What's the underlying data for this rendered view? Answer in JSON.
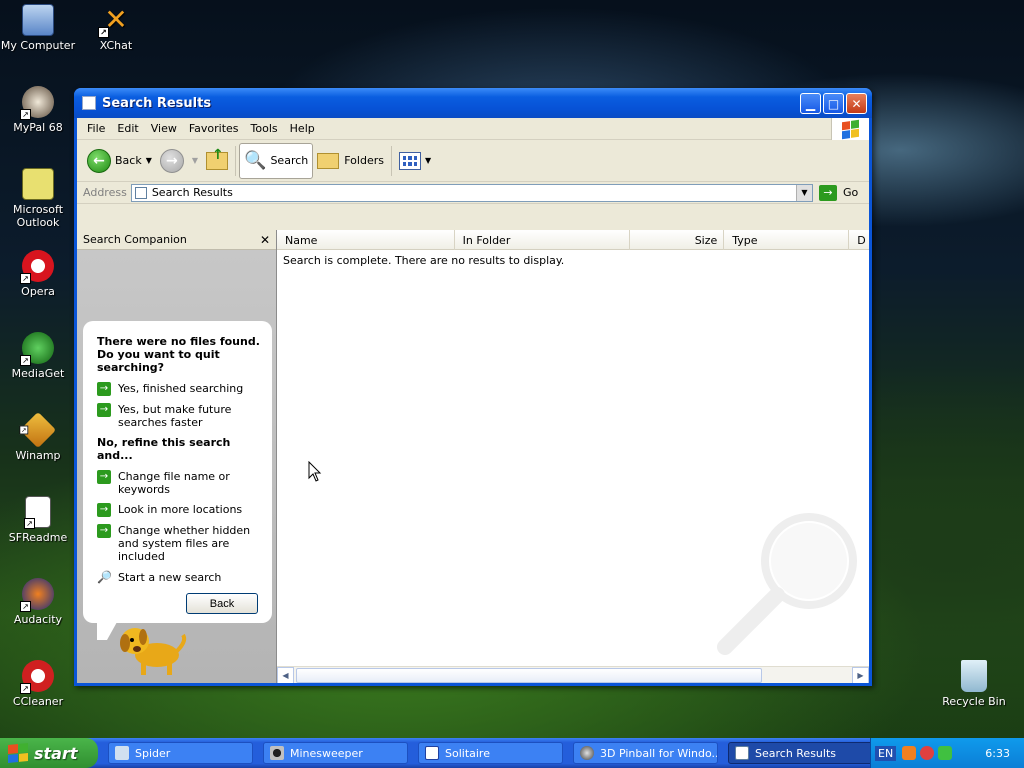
{
  "desktop": {
    "icons": [
      {
        "label": "My Computer"
      },
      {
        "label": "XChat"
      },
      {
        "label": "MyPal 68"
      },
      {
        "label": "Microsoft Outlook"
      },
      {
        "label": "Opera"
      },
      {
        "label": "MediaGet"
      },
      {
        "label": "Winamp"
      },
      {
        "label": "SFReadme"
      },
      {
        "label": "Audacity"
      },
      {
        "label": "CCleaner"
      },
      {
        "label": "Recycle Bin"
      }
    ]
  },
  "window": {
    "title": "Search Results",
    "menu": [
      "File",
      "Edit",
      "View",
      "Favorites",
      "Tools",
      "Help"
    ],
    "toolbar": {
      "back": "Back",
      "search": "Search",
      "folders": "Folders"
    },
    "address": {
      "label": "Address",
      "value": "Search Results",
      "go": "Go"
    },
    "companion": {
      "title": "Search Companion",
      "heading": "There were no files found. Do you want to quit searching?",
      "options": [
        "Yes, finished searching",
        "Yes, but make future searches faster"
      ],
      "refine_heading": "No, refine this search and...",
      "refine_options": [
        "Change file name or keywords",
        "Look in more locations",
        "Change whether hidden and system files are included"
      ],
      "new_search": "Start a new search",
      "back_button": "Back"
    },
    "columns": [
      "Name",
      "In Folder",
      "Size",
      "Type",
      "D"
    ],
    "status_message": "Search is complete. There are no results to display."
  },
  "taskbar": {
    "start": "start",
    "tasks": [
      "Spider",
      "Minesweeper",
      "Solitaire",
      "3D Pinball for Windo...",
      "Search Results"
    ],
    "language": "EN",
    "clock": "6:33"
  },
  "colors": {
    "accent": "#0a55d8",
    "go_green": "#2c9a1e"
  }
}
